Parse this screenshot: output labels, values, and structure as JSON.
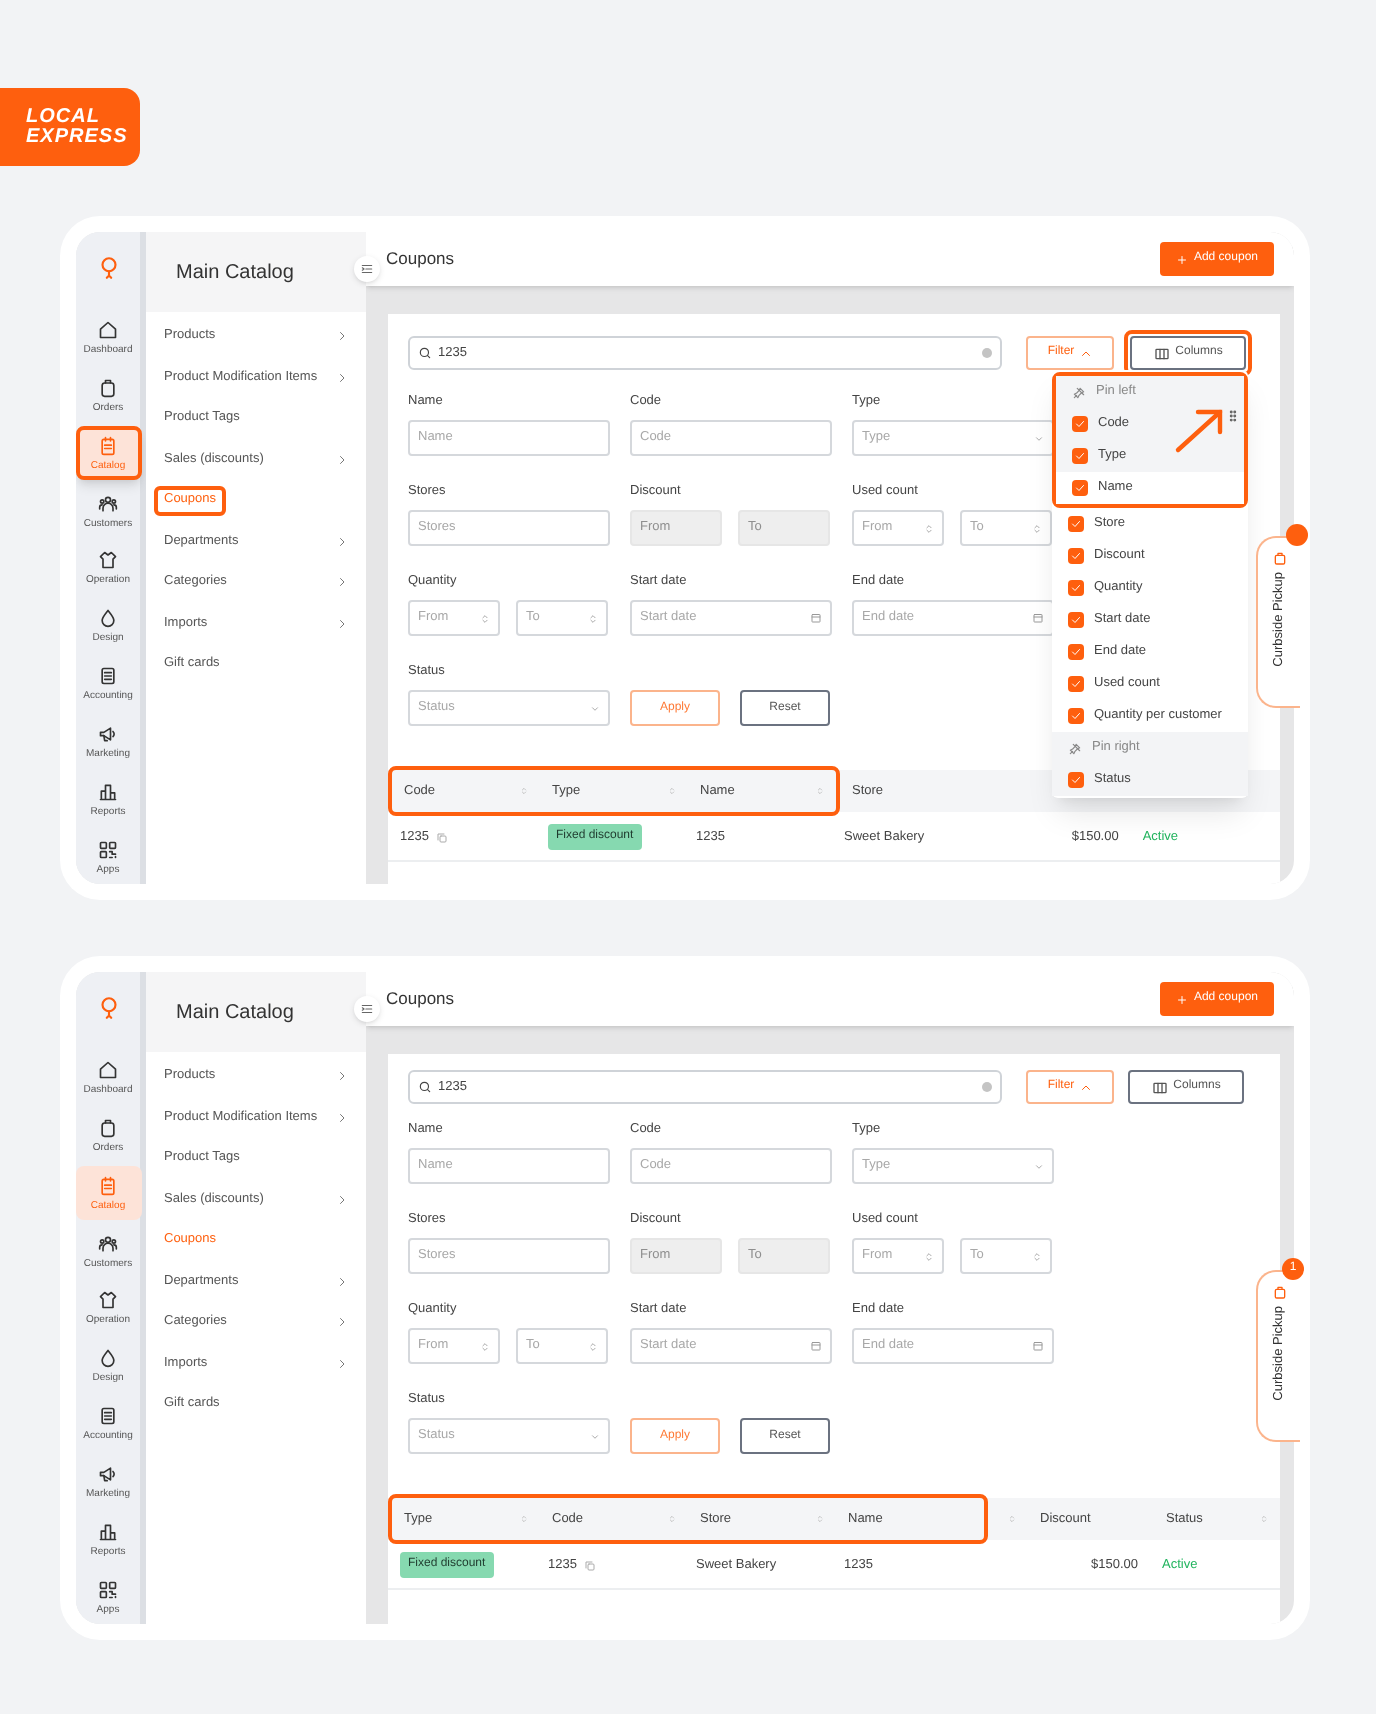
{
  "logo": {
    "line_1": "LOCAL",
    "line_2": "EXPRESS"
  },
  "panels": [
    {
      "rail": [
        {
          "label": "Dashboard",
          "selected": false,
          "highlighted": false
        },
        {
          "label": "Orders",
          "selected": false,
          "highlighted": false
        },
        {
          "label": "Catalog",
          "selected": true,
          "highlighted": true
        },
        {
          "label": "Customers",
          "selected": false,
          "highlighted": false
        },
        {
          "label": "Operation",
          "selected": false,
          "highlighted": false
        },
        {
          "label": "Design",
          "selected": false,
          "highlighted": false
        },
        {
          "label": "Accounting",
          "selected": false,
          "highlighted": false
        },
        {
          "label": "Marketing",
          "selected": false,
          "highlighted": false
        },
        {
          "label": "Reports",
          "selected": false,
          "highlighted": false
        },
        {
          "label": "Apps",
          "selected": false,
          "highlighted": false
        }
      ],
      "menu": {
        "title": "Main Catalog",
        "items": [
          {
            "label": "Products",
            "has_children": true,
            "selected": false,
            "highlighted": false
          },
          {
            "label": "Product Modification Items",
            "has_children": true,
            "selected": false,
            "highlighted": false
          },
          {
            "label": "Product Tags",
            "has_children": false,
            "selected": false,
            "highlighted": false
          },
          {
            "label": "Sales (discounts)",
            "has_children": true,
            "selected": false,
            "highlighted": false
          },
          {
            "label": "Coupons",
            "has_children": false,
            "selected": true,
            "highlighted": true
          },
          {
            "label": "Departments",
            "has_children": true,
            "selected": false,
            "highlighted": false
          },
          {
            "label": "Categories",
            "has_children": true,
            "selected": false,
            "highlighted": false
          },
          {
            "label": "Imports",
            "has_children": true,
            "selected": false,
            "highlighted": false
          },
          {
            "label": "Gift cards",
            "has_children": false,
            "selected": false,
            "highlighted": false
          }
        ]
      },
      "page_title": "Coupons",
      "add_button": "Add coupon",
      "search": {
        "value": "1235"
      },
      "filter_button": {
        "label": "Filter",
        "expanded": true
      },
      "columns_button": {
        "label": "Columns",
        "highlighted": true
      },
      "fields": [
        {
          "kind": "text",
          "label": "Name",
          "placeholder": "Name"
        },
        {
          "kind": "text",
          "label": "Code",
          "placeholder": "Code"
        },
        {
          "kind": "select",
          "label": "Type",
          "placeholder": "Type"
        },
        {
          "kind": "text",
          "label": "Stores",
          "placeholder": "Stores"
        },
        {
          "kind": "range",
          "label": "Discount",
          "from_placeholder": "From",
          "to_placeholder": "To",
          "disabled": true,
          "stepper": false
        },
        {
          "kind": "range",
          "label": "Used count",
          "from_placeholder": "From",
          "to_placeholder": "To",
          "disabled": false,
          "stepper": true
        },
        {
          "kind": "range",
          "label": "Quantity",
          "from_placeholder": "From",
          "to_placeholder": "To",
          "disabled": false,
          "stepper": true
        },
        {
          "kind": "date",
          "label": "Start date",
          "placeholder": "Start date"
        },
        {
          "kind": "date",
          "label": "End date",
          "placeholder": "End date"
        }
      ],
      "status_field": {
        "label": "Status",
        "placeholder": "Status"
      },
      "apply_button": "Apply",
      "reset_button": "Reset",
      "table": {
        "columns": [
          {
            "label": "Code",
            "sortable": true,
            "highlighted": true
          },
          {
            "label": "Type",
            "sortable": true,
            "highlighted": true
          },
          {
            "label": "Name",
            "sortable": true,
            "highlighted": true
          },
          {
            "label": "Store",
            "sortable": false,
            "highlighted": false
          }
        ],
        "rows": [
          {
            "cells": [
              {
                "kind": "code",
                "text": "1235"
              },
              {
                "kind": "badge",
                "text": "Fixed discount"
              },
              {
                "kind": "text",
                "text": "1235"
              },
              {
                "kind": "text",
                "text": "Sweet Bakery"
              },
              {
                "kind": "money",
                "text": "$150.00"
              },
              {
                "kind": "status",
                "text": "Active"
              }
            ]
          }
        ]
      },
      "columns_menu": {
        "drag_hint": true,
        "rows": [
          {
            "kind": "section",
            "label": "Pin left",
            "pinned": true,
            "highlighted": true
          },
          {
            "kind": "option",
            "label": "Code",
            "checked": true,
            "pinned": true,
            "highlighted": true
          },
          {
            "kind": "option",
            "label": "Type",
            "checked": true,
            "pinned": true,
            "highlighted": true
          },
          {
            "kind": "option",
            "label": "Name",
            "checked": true,
            "pinned": false,
            "highlighted": true
          },
          {
            "kind": "option",
            "label": "Store",
            "checked": true,
            "pinned": false,
            "highlighted": false
          },
          {
            "kind": "option",
            "label": "Discount",
            "checked": true,
            "pinned": false,
            "highlighted": false
          },
          {
            "kind": "option",
            "label": "Quantity",
            "checked": true,
            "pinned": false,
            "highlighted": false
          },
          {
            "kind": "option",
            "label": "Start date",
            "checked": true,
            "pinned": false,
            "highlighted": false
          },
          {
            "kind": "option",
            "label": "End date",
            "checked": true,
            "pinned": false,
            "highlighted": false
          },
          {
            "kind": "option",
            "label": "Used count",
            "checked": true,
            "pinned": false,
            "highlighted": false
          },
          {
            "kind": "option",
            "label": "Quantity per customer",
            "checked": true,
            "pinned": false,
            "highlighted": false
          },
          {
            "kind": "section",
            "label": "Pin right",
            "pinned": true,
            "highlighted": false
          },
          {
            "kind": "option",
            "label": "Status",
            "checked": true,
            "pinned": true,
            "highlighted": false
          }
        ]
      },
      "curbside": {
        "label": "Curbside Pickup",
        "notification_dot": true
      }
    },
    {
      "rail": [
        {
          "label": "Dashboard",
          "selected": false,
          "highlighted": false
        },
        {
          "label": "Orders",
          "selected": false,
          "highlighted": false
        },
        {
          "label": "Catalog",
          "selected": true,
          "highlighted": false
        },
        {
          "label": "Customers",
          "selected": false,
          "highlighted": false
        },
        {
          "label": "Operation",
          "selected": false,
          "highlighted": false
        },
        {
          "label": "Design",
          "selected": false,
          "highlighted": false
        },
        {
          "label": "Accounting",
          "selected": false,
          "highlighted": false
        },
        {
          "label": "Marketing",
          "selected": false,
          "highlighted": false
        },
        {
          "label": "Reports",
          "selected": false,
          "highlighted": false
        },
        {
          "label": "Apps",
          "selected": false,
          "highlighted": false
        }
      ],
      "menu": {
        "title": "Main Catalog",
        "items": [
          {
            "label": "Products",
            "has_children": true,
            "selected": false,
            "highlighted": false
          },
          {
            "label": "Product Modification Items",
            "has_children": true,
            "selected": false,
            "highlighted": false
          },
          {
            "label": "Product Tags",
            "has_children": false,
            "selected": false,
            "highlighted": false
          },
          {
            "label": "Sales (discounts)",
            "has_children": true,
            "selected": false,
            "highlighted": false
          },
          {
            "label": "Coupons",
            "has_children": false,
            "selected": true,
            "highlighted": false
          },
          {
            "label": "Departments",
            "has_children": true,
            "selected": false,
            "highlighted": false
          },
          {
            "label": "Categories",
            "has_children": true,
            "selected": false,
            "highlighted": false
          },
          {
            "label": "Imports",
            "has_children": true,
            "selected": false,
            "highlighted": false
          },
          {
            "label": "Gift cards",
            "has_children": false,
            "selected": false,
            "highlighted": false
          }
        ]
      },
      "page_title": "Coupons",
      "add_button": "Add coupon",
      "search": {
        "value": "1235"
      },
      "filter_button": {
        "label": "Filter",
        "expanded": true
      },
      "columns_button": {
        "label": "Columns",
        "highlighted": false
      },
      "fields": [
        {
          "kind": "text",
          "label": "Name",
          "placeholder": "Name"
        },
        {
          "kind": "text",
          "label": "Code",
          "placeholder": "Code"
        },
        {
          "kind": "select",
          "label": "Type",
          "placeholder": "Type"
        },
        {
          "kind": "text",
          "label": "Stores",
          "placeholder": "Stores"
        },
        {
          "kind": "range",
          "label": "Discount",
          "from_placeholder": "From",
          "to_placeholder": "To",
          "disabled": true,
          "stepper": false
        },
        {
          "kind": "range",
          "label": "Used count",
          "from_placeholder": "From",
          "to_placeholder": "To",
          "disabled": false,
          "stepper": true
        },
        {
          "kind": "range",
          "label": "Quantity",
          "from_placeholder": "From",
          "to_placeholder": "To",
          "disabled": false,
          "stepper": true
        },
        {
          "kind": "date",
          "label": "Start date",
          "placeholder": "Start date"
        },
        {
          "kind": "date",
          "label": "End date",
          "placeholder": "End date"
        }
      ],
      "status_field": {
        "label": "Status",
        "placeholder": "Status"
      },
      "apply_button": "Apply",
      "reset_button": "Reset",
      "table": {
        "columns": [
          {
            "label": "Type",
            "sortable": true,
            "highlighted": true
          },
          {
            "label": "Code",
            "sortable": true,
            "highlighted": true
          },
          {
            "label": "Store",
            "sortable": true,
            "highlighted": true
          },
          {
            "label": "Name",
            "sortable": false,
            "highlighted": true
          },
          {
            "sortable": true,
            "highlighted": false
          },
          {
            "label": "Discount",
            "sortable": false,
            "highlighted": false
          },
          {
            "label": "Status",
            "sortable": true,
            "highlighted": false
          }
        ],
        "rows": [
          {
            "cells": [
              {
                "kind": "badge",
                "text": "Fixed discount"
              },
              {
                "kind": "code",
                "text": "1235"
              },
              {
                "kind": "text",
                "text": "Sweet Bakery"
              },
              {
                "kind": "text",
                "text": "1235"
              },
              {
                "kind": "empty"
              },
              {
                "kind": "money",
                "text": "$150.00"
              },
              {
                "kind": "status",
                "text": "Active"
              }
            ]
          }
        ]
      },
      "curbside": {
        "label": "Curbside Pickup",
        "badge": "1"
      }
    }
  ]
}
